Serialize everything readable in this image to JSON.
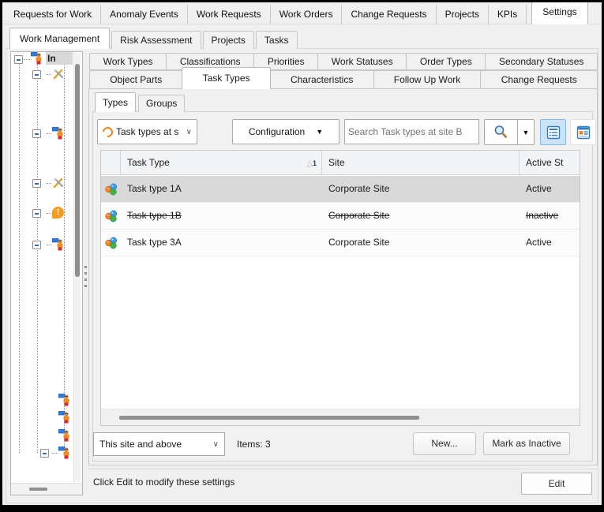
{
  "top_tabs": {
    "items": [
      "Requests for Work",
      "Anomaly Events",
      "Work Requests",
      "Work Orders",
      "Change Requests",
      "Projects",
      "KPIs",
      "Settings"
    ],
    "selected": "Settings"
  },
  "settings_tabs": {
    "items": [
      "Work Management",
      "Risk Assessment",
      "Projects",
      "Tasks"
    ],
    "selected": "Work Management"
  },
  "tree": {
    "root_label": "In"
  },
  "inner_tabs": {
    "row1": [
      "Work Types",
      "Classifications",
      "Priorities",
      "Work Statuses",
      "Order Types",
      "Secondary Statuses"
    ],
    "row2": [
      "Object Parts",
      "Task Types",
      "Characteristics",
      "Follow Up Work",
      "Change Requests"
    ],
    "selected": "Task Types"
  },
  "view_tabs": {
    "items": [
      "Types",
      "Groups"
    ],
    "selected": "Types"
  },
  "toolbar": {
    "views_dropdown_value": "Task types at s",
    "configuration_label": "Configuration",
    "search_placeholder": "Search Task types at site B"
  },
  "table": {
    "columns": {
      "icon": "",
      "task_type": "Task Type",
      "site": "Site",
      "active_status": "Active St"
    },
    "sort": {
      "glyph": "△",
      "order": "1",
      "column": "Task Type",
      "direction": "ascending"
    },
    "rows": [
      {
        "task_type": "Task type 1A",
        "site": "Corporate Site",
        "status": "Active",
        "selected": true,
        "inactive": false
      },
      {
        "task_type": "Task type 1B",
        "site": "Corporate Site",
        "status": "Inactive",
        "selected": false,
        "inactive": true
      },
      {
        "task_type": "Task type 3A",
        "site": "Corporate Site",
        "status": "Active",
        "selected": false,
        "inactive": false
      }
    ]
  },
  "footer": {
    "scope_dropdown_value": "This site and above",
    "items_count": "Items: 3",
    "new_button": "New...",
    "mark_inactive_button": "Mark as Inactive"
  },
  "status_bar": {
    "message": "Click Edit to modify these settings",
    "edit_button": "Edit"
  },
  "icons": {
    "refresh-icon": "orange circular arrow",
    "search-icon": "magnifier",
    "dropdown-arrow-icon": "▾",
    "chevron-down-icon": "∨",
    "list-view-icon": "blue list",
    "card-view-icon": "blue card with orange block",
    "task-type-icon": "three balloons orange/blue/green",
    "person-icon": "worker with blue flag",
    "tools-icon": "crossed tools",
    "alert-icon": "orange exclamation",
    "collapse-icon": "minus box"
  },
  "colors": {
    "background": "#f0f0f0",
    "selection_row": "#d9d9d9",
    "accent_blue": "#2f7ac4",
    "view_button_selected_bg": "#cbe3f6",
    "orange": "#e8831d",
    "border": "#c9c9c9"
  }
}
